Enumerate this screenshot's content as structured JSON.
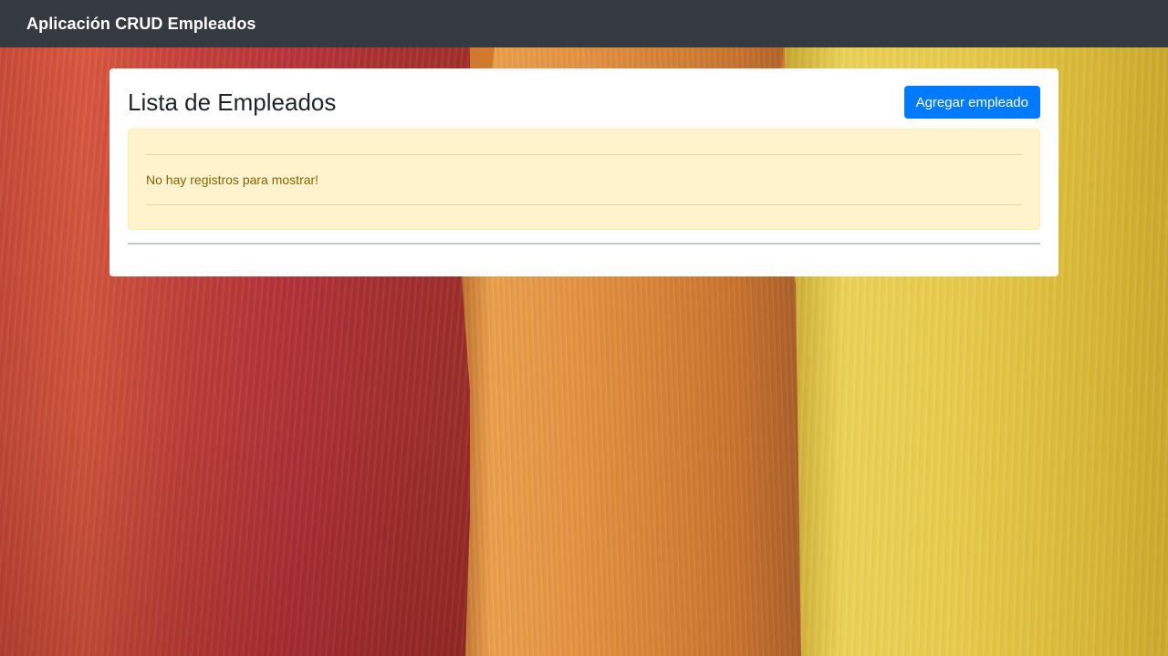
{
  "navbar": {
    "brand": "Aplicación CRUD Empleados"
  },
  "main": {
    "title": "Lista de Empleados",
    "add_button_label": "Agregar empleado",
    "empty_message": "No hay registros para mostrar!"
  },
  "colors": {
    "navbar_bg": "#343a40",
    "primary_button": "#007bff",
    "alert_bg": "#fff3cd",
    "alert_text": "#856404"
  }
}
